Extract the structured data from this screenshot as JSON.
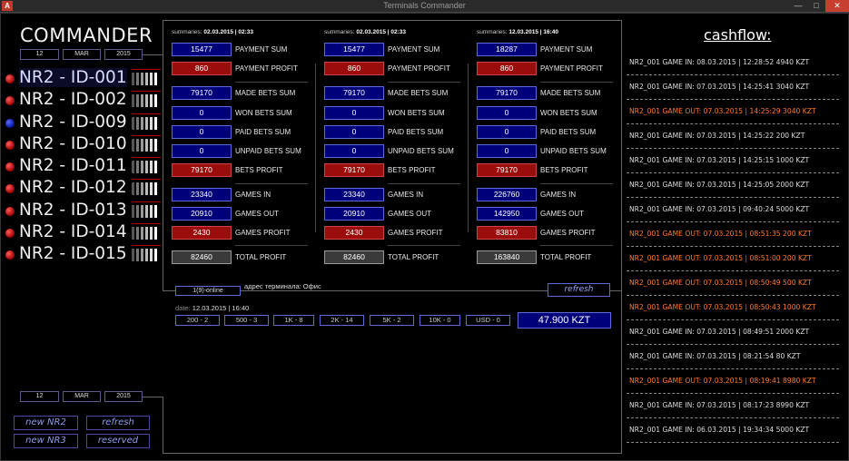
{
  "window": {
    "title": "Terminals Commander",
    "icon_text": "A",
    "min": "—",
    "max": "□",
    "close": "✕"
  },
  "app": {
    "logo": "COMMANDER"
  },
  "top_date": {
    "day": "12",
    "month": "MAR",
    "year": "2015"
  },
  "bottom_date": {
    "day": "12",
    "month": "MAR",
    "year": "2015"
  },
  "terminals": [
    {
      "name": "NR2 - ID-001",
      "status": "red",
      "selected": true
    },
    {
      "name": "NR2 - ID-002",
      "status": "red",
      "selected": false
    },
    {
      "name": "NR2 - ID-009",
      "status": "blue",
      "selected": false
    },
    {
      "name": "NR2 - ID-010",
      "status": "red",
      "selected": false
    },
    {
      "name": "NR2 - ID-011",
      "status": "red",
      "selected": false
    },
    {
      "name": "NR2 - ID-012",
      "status": "red",
      "selected": false
    },
    {
      "name": "NR2 - ID-013",
      "status": "red",
      "selected": false
    },
    {
      "name": "NR2 - ID-014",
      "status": "red",
      "selected": false
    },
    {
      "name": "NR2 - ID-015",
      "status": "red",
      "selected": false
    }
  ],
  "buttons": {
    "new_nr2": "new NR2",
    "refresh": "refresh",
    "new_nr3": "new NR3",
    "reserved": "reserved",
    "refresh_mid": "refresh"
  },
  "summaries": [
    {
      "header_label": "summaries:",
      "header_value": "02.03.2015 | 02:33",
      "payment_sum": "15477",
      "payment_profit": "860",
      "made_bets_sum": "79170",
      "won_bets_sum": "0",
      "paid_bets_sum": "0",
      "unpaid_bets_sum": "0",
      "bets_profit": "79170",
      "games_in": "23340",
      "games_out": "20910",
      "games_profit": "2430",
      "total_profit": "82460"
    },
    {
      "header_label": "summaries:",
      "header_value": "02.03.2015 | 02:33",
      "payment_sum": "15477",
      "payment_profit": "860",
      "made_bets_sum": "79170",
      "won_bets_sum": "0",
      "paid_bets_sum": "0",
      "unpaid_bets_sum": "0",
      "bets_profit": "79170",
      "games_in": "23340",
      "games_out": "20910",
      "games_profit": "2430",
      "total_profit": "82460"
    },
    {
      "header_label": "summaries:",
      "header_value": "12.03.2015 | 16:40",
      "payment_sum": "18287",
      "payment_profit": "860",
      "made_bets_sum": "79170",
      "won_bets_sum": "0",
      "paid_bets_sum": "0",
      "unpaid_bets_sum": "0",
      "bets_profit": "79170",
      "games_in": "226760",
      "games_out": "142950",
      "games_profit": "83810",
      "total_profit": "163840"
    }
  ],
  "labels": {
    "payment_sum": "PAYMENT SUM",
    "payment_profit": "PAYMENT PROFIT",
    "made_bets_sum": "MADE BETS SUM",
    "won_bets_sum": "WON BETS SUM",
    "paid_bets_sum": "PAID BETS SUM",
    "unpaid_bets_sum": "UNPAID BETS SUM",
    "bets_profit": "BETS PROFIT",
    "games_in": "GAMES IN",
    "games_out": "GAMES OUT",
    "games_profit": "GAMES PROFIT",
    "total_profit": "TOTAL PROFIT"
  },
  "status": {
    "online": "1(9)-online",
    "address": "адрес терминала: Офис",
    "date_label": "date:",
    "date_value": "12.03.2015 | 16:40"
  },
  "denominations": [
    "200 - 2",
    "500 - 3",
    "1K - 8",
    "2K - 14",
    "5K - 2",
    "10K - 0",
    "USD - 0"
  ],
  "total_kzt": "47.900 KZT",
  "cashflow": {
    "title": "cashflow:",
    "items": [
      {
        "text": "NR2_001 GAME IN: 08.03.2015 | 12:28:52 4940 KZT",
        "type": "in"
      },
      {
        "text": "NR2_001 GAME IN: 07.03.2015 | 14:25:41 3040 KZT",
        "type": "in"
      },
      {
        "text": "NR2_001 GAME OUT: 07.03.2015 | 14:25:29 3040 KZT",
        "type": "out"
      },
      {
        "text": "NR2_001 GAME IN: 07.03.2015 | 14:25:22 200 KZT",
        "type": "in"
      },
      {
        "text": "NR2_001 GAME IN: 07.03.2015 | 14:25:15 1000 KZT",
        "type": "in"
      },
      {
        "text": "NR2_001 GAME IN: 07.03.2015 | 14:25:05 2000 KZT",
        "type": "in"
      },
      {
        "text": "NR2_001 GAME IN: 07.03.2015 | 09:40:24 5000 KZT",
        "type": "in"
      },
      {
        "text": "NR2_001 GAME OUT: 07.03.2015 | 08:51:35 200 KZT",
        "type": "out"
      },
      {
        "text": "NR2_001 GAME OUT: 07.03.2015 | 08:51:00 200 KZT",
        "type": "out"
      },
      {
        "text": "NR2_001 GAME OUT: 07.03.2015 | 08:50:49 500 KZT",
        "type": "out"
      },
      {
        "text": "NR2_001 GAME OUT: 07.03.2015 | 08:50:43 1000 KZT",
        "type": "out"
      },
      {
        "text": "NR2_001 GAME IN: 07.03.2015 | 08:49:51 2000 KZT",
        "type": "in"
      },
      {
        "text": "NR2_001 GAME IN: 07.03.2015 | 08:21:54 80 KZT",
        "type": "in"
      },
      {
        "text": "NR2_001 GAME OUT: 07.03.2015 | 08:19:41 8980 KZT",
        "type": "out"
      },
      {
        "text": "NR2_001 GAME IN: 07.03.2015 | 08:17:23 8990 KZT",
        "type": "in"
      },
      {
        "text": "NR2_001 GAME IN: 06.03.2015 | 19:34:34 5000 KZT",
        "type": "in"
      }
    ]
  }
}
